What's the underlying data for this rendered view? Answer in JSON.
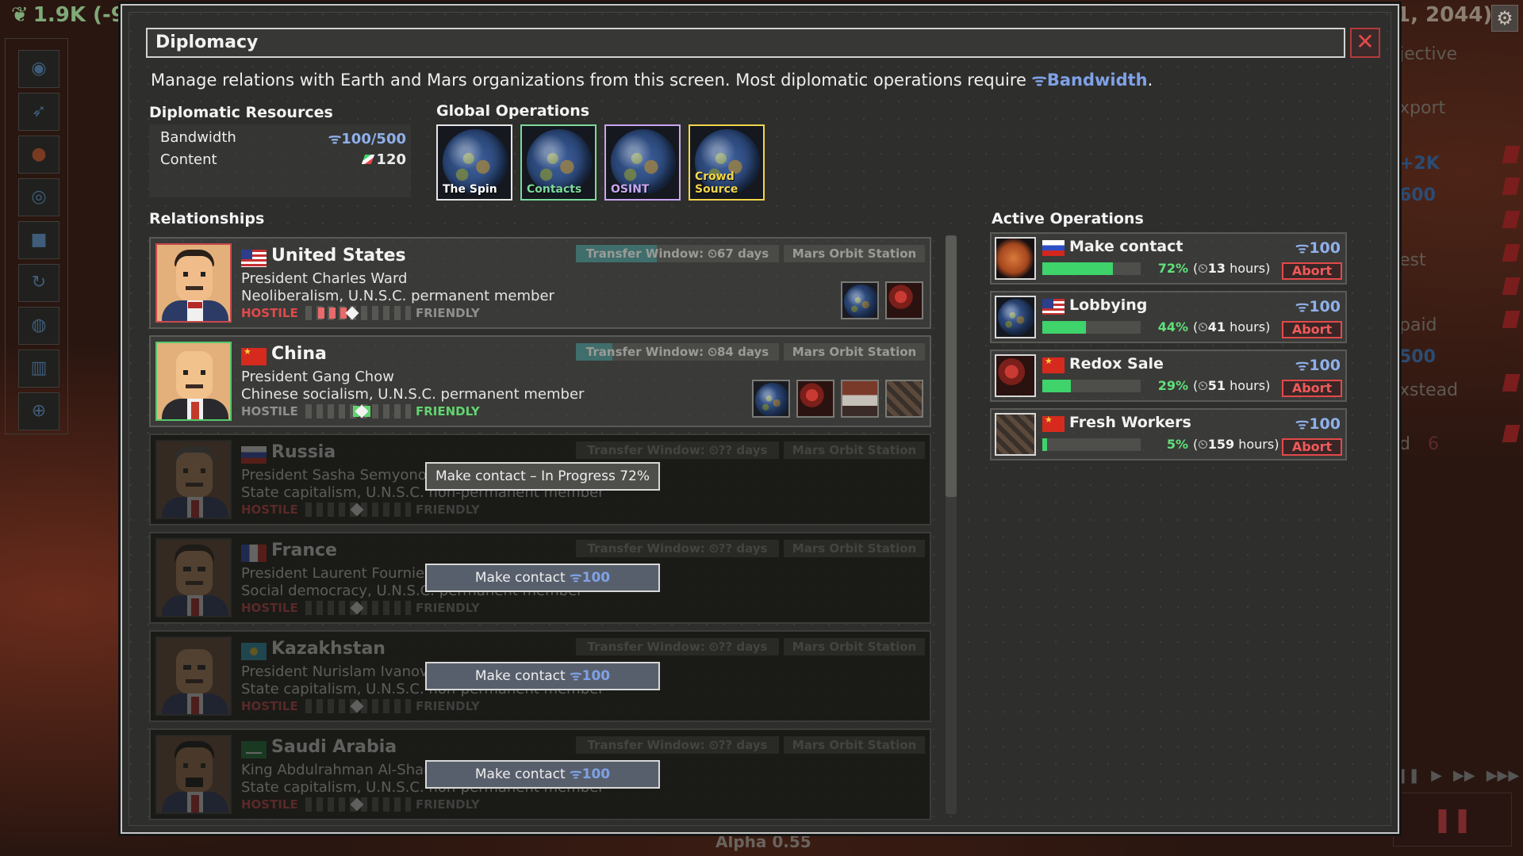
{
  "background": {
    "resource_readout": "1.9K (-9",
    "date_fragment": "1, 2044)",
    "side_texts": [
      "jective",
      "xport",
      "+2K",
      "600",
      "est",
      "paid",
      "500",
      "xstead",
      "d",
      "6"
    ],
    "alpha": "Alpha 0.55"
  },
  "dialog": {
    "title": "Diplomacy",
    "close_glyph": "✕",
    "intro": "Manage relations with Earth and Mars organizations from this screen. Most diplomatic operations require",
    "intro_resource": "Bandwidth",
    "intro_end": "."
  },
  "resources": {
    "heading": "Diplomatic Resources",
    "bandwidth_label": "Bandwidth",
    "bandwidth_value": "100/500",
    "content_label": "Content",
    "content_value": "120"
  },
  "global_ops": {
    "heading": "Global Operations",
    "items": [
      {
        "label": "The Spin",
        "color": "#ffffff",
        "border": "#e6e6e6"
      },
      {
        "label": "Contacts",
        "color": "#7ed99b",
        "border": "#7ed99b"
      },
      {
        "label": "OSINT",
        "color": "#c9a6ef",
        "border": "#c9a6ef"
      },
      {
        "label": "Crowd Source",
        "color": "#f2d64a",
        "border": "#f2d64a"
      }
    ]
  },
  "relationships": {
    "heading": "Relationships",
    "hostile": "HOSTILE",
    "friendly": "FRIENDLY",
    "station": "Mars Orbit Station",
    "items": [
      {
        "country": "United States",
        "leader": "President Charles Ward",
        "ideology": "Neoliberalism, U.N.S.C. permanent member",
        "transfer": "Transfer Window: ⏲67 days",
        "transfer_progress": 0.4,
        "relation": 0.45,
        "state": "hostile"
      },
      {
        "country": "China",
        "leader": "President Gang Chow",
        "ideology": "Chinese socialism, U.N.S.C. permanent member",
        "transfer": "Transfer Window: ⏲84 days",
        "transfer_progress": 0.18,
        "relation": 0.55,
        "state": "friendly"
      },
      {
        "country": "Russia",
        "leader": "President Sasha Semyonov",
        "ideology": "State capitalism, U.N.S.C. non-permanent member",
        "transfer": "Transfer Window: ⏲?? days",
        "relation": 0.5,
        "overlay": "Make contact – In Progress 72%"
      },
      {
        "country": "France",
        "leader": "President Laurent Fournier",
        "ideology": "Social democracy, U.N.S.C. permanent member",
        "transfer": "Transfer Window: ⏲?? days",
        "relation": 0.5,
        "overlay": "Make contact",
        "overlay_cost": "100"
      },
      {
        "country": "Kazakhstan",
        "leader": "President Nurislam Ivanov",
        "ideology": "State capitalism, U.N.S.C. non-permanent member",
        "transfer": "Transfer Window: ⏲?? days",
        "relation": 0.5,
        "overlay": "Make contact",
        "overlay_cost": "100"
      },
      {
        "country": "Saudi Arabia",
        "leader": "King Abdulrahman Al-Shammari",
        "ideology": "State capitalism, U.N.S.C. non-permanent member",
        "transfer": "Transfer Window: ⏲?? days",
        "relation": 0.5,
        "overlay": "Make contact",
        "overlay_cost": "100"
      }
    ]
  },
  "active_ops": {
    "heading": "Active Operations",
    "abort": "Abort",
    "items": [
      {
        "name": "Make contact",
        "cost": "100",
        "progress": 0.72,
        "pct": "72%",
        "time_pre": "(⏲",
        "time_num": "13",
        "time_post": " hours)"
      },
      {
        "name": "Lobbying",
        "cost": "100",
        "progress": 0.44,
        "pct": "44%",
        "time_pre": "(⏲",
        "time_num": "41",
        "time_post": " hours)"
      },
      {
        "name": "Redox Sale",
        "cost": "100",
        "progress": 0.29,
        "pct": "29%",
        "time_pre": "(⏲",
        "time_num": "51",
        "time_post": " hours)"
      },
      {
        "name": "Fresh Workers",
        "cost": "100",
        "progress": 0.05,
        "pct": "5%",
        "time_pre": "(⏲",
        "time_num": "159",
        "time_post": " hours)"
      }
    ]
  }
}
